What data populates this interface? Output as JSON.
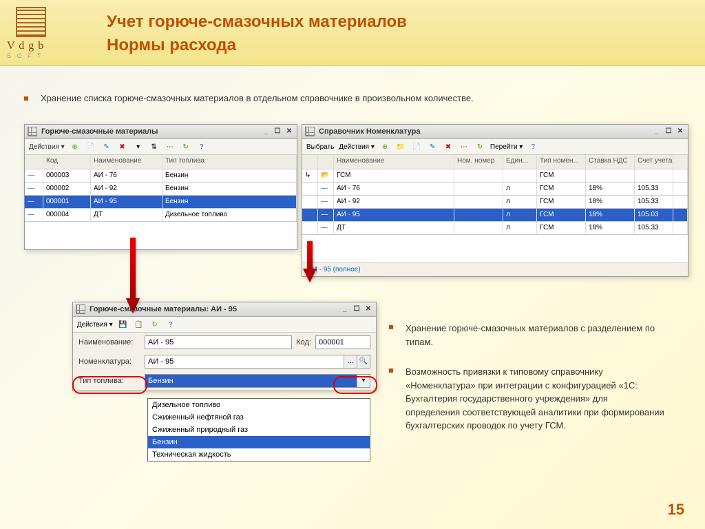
{
  "header": {
    "logo_text": "V d g b",
    "logo_sub": "S O F T",
    "title1": "Учет горюче-смазочных материалов",
    "title2": "Нормы расхода"
  },
  "intro": "Хранение списка горюче-смазочных материалов в отдельном справочнике в произвольном количестве.",
  "side_bullets": [
    "Хранение горюче-смазочных материалов с разделением по типам.",
    "Возможность привязки к типовому справочнику «Номенклатура» при интеграции с конфигурацией «1С: Бухгалтерия государственного учреждения» для определения соответствующей аналитики при формировании бухгалтерских проводок по учету ГСМ."
  ],
  "page_num": "15",
  "win1": {
    "title": "Горюче-смазочные материалы",
    "actions": "Действия ▾",
    "cols": [
      "",
      "Код",
      "Наименование",
      "Тип топлива"
    ],
    "rows": [
      {
        "code": "000003",
        "name": "АИ - 76",
        "type": "Бензин"
      },
      {
        "code": "000002",
        "name": "АИ - 92",
        "type": "Бензин"
      },
      {
        "code": "000001",
        "name": "АИ - 95",
        "type": "Бензин"
      },
      {
        "code": "000004",
        "name": "ДТ",
        "type": "Дизельное топливо"
      }
    ]
  },
  "win2": {
    "title": "Справочник Номенклатура",
    "select": "Выбрать",
    "actions": "Действия ▾",
    "goto": "Перейти ▾",
    "cols": [
      "",
      "",
      "Наименование",
      "Ном. номер",
      "Един...",
      "Тип номен...",
      "Ставка НДС",
      "Счет учета"
    ],
    "folder": "ГСМ",
    "folder_type": "ГСМ",
    "rows": [
      {
        "name": "АИ - 76",
        "unit": "л",
        "type": "ГСМ",
        "vat": "18%",
        "acc": "105.33"
      },
      {
        "name": "АИ - 92",
        "unit": "л",
        "type": "ГСМ",
        "vat": "18%",
        "acc": "105.33"
      },
      {
        "name": "АИ - 95",
        "unit": "л",
        "type": "ГСМ",
        "vat": "18%",
        "acc": "105.03"
      },
      {
        "name": "ДТ",
        "unit": "л",
        "type": "ГСМ",
        "vat": "18%",
        "acc": "105.33"
      }
    ],
    "footer": "АИ - 95 (полное)"
  },
  "win3": {
    "title": "Горюче-смазочные материалы: АИ - 95",
    "actions": "Действия ▾",
    "label_name": "Наименование:",
    "val_name": "АИ - 95",
    "label_code": "Код:",
    "val_code": "000001",
    "label_nomen": "Номенклатура:",
    "val_nomen": "АИ - 95",
    "label_fuel": "Тип топлива:",
    "val_fuel": "Бензин",
    "options": [
      "Дизельное топливо",
      "Сжиженный нефтяной газ",
      "Сжиженный природный газ",
      "Бензин",
      "Техническая жидкость"
    ]
  }
}
